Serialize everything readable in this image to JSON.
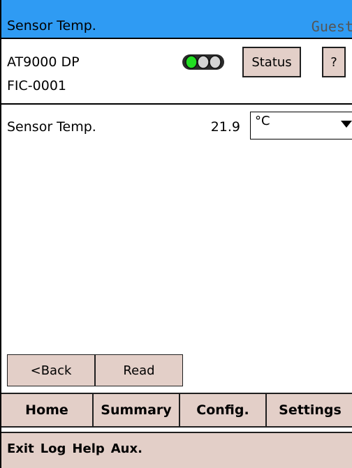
{
  "header": {
    "title": "Sensor Temp.",
    "user": "Guest"
  },
  "device": {
    "model": "AT9000 DP",
    "tag": "FIC-0001",
    "indicator_icon": "status-lights-icon",
    "indicator_colors": [
      "#22dd22",
      "#cccccc",
      "#cccccc"
    ]
  },
  "top_buttons": {
    "status_label": "Status",
    "help_label": "?"
  },
  "parameter": {
    "label": "Sensor Temp.",
    "value": "21.9",
    "unit": "°C"
  },
  "actions": {
    "back_label": "<Back",
    "read_label": "Read"
  },
  "nav": {
    "home": "Home",
    "summary": "Summary",
    "config": "Config.",
    "settings": "Settings"
  },
  "menu": {
    "exit": "Exit",
    "log": "Log",
    "help": "Help",
    "aux": "Aux."
  },
  "colors": {
    "titlebar": "#2f9bf3",
    "button_bg": "#e3cfc8"
  }
}
